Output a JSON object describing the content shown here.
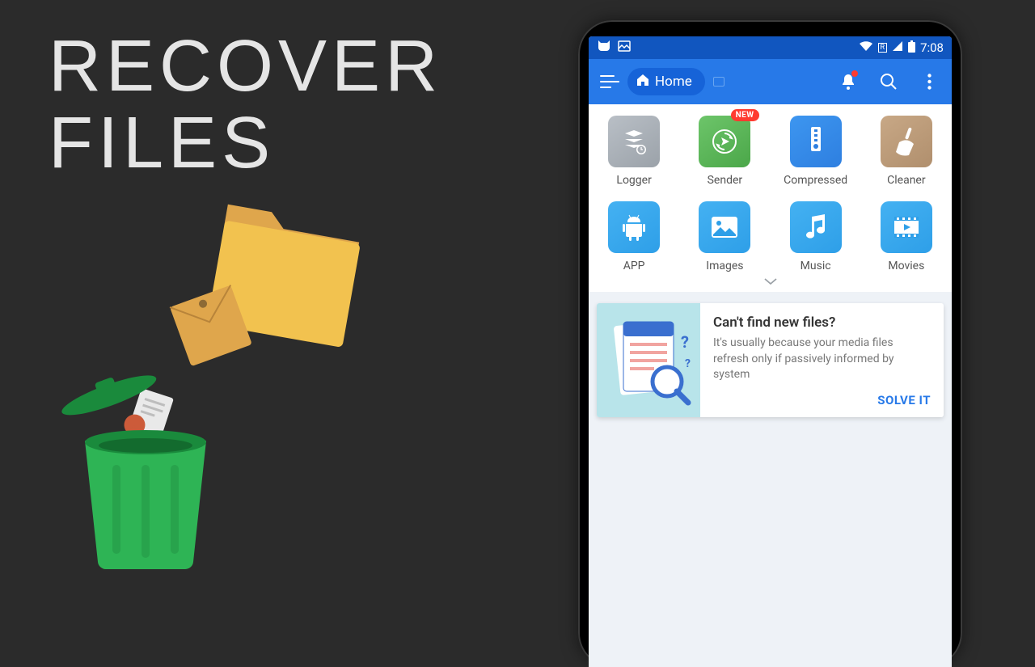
{
  "headline": {
    "line1": "RECOVER",
    "line2": "FILES"
  },
  "statusbar": {
    "time": "7:08",
    "roaming": "R"
  },
  "toolbar": {
    "home_label": "Home"
  },
  "apps": [
    {
      "label": "Logger",
      "tile": "t-grey",
      "badge": ""
    },
    {
      "label": "Sender",
      "tile": "t-green",
      "badge": "NEW"
    },
    {
      "label": "Compressed",
      "tile": "t-blue",
      "badge": ""
    },
    {
      "label": "Cleaner",
      "tile": "t-brown",
      "badge": ""
    },
    {
      "label": "APP",
      "tile": "t-sky",
      "badge": ""
    },
    {
      "label": "Images",
      "tile": "t-sky",
      "badge": ""
    },
    {
      "label": "Music",
      "tile": "t-sky",
      "badge": ""
    },
    {
      "label": "Movies",
      "tile": "t-sky",
      "badge": ""
    }
  ],
  "tip": {
    "title": "Can't find new files?",
    "desc": "It's usually because your media files refresh only if passively informed by system",
    "action": "SOLVE IT"
  }
}
